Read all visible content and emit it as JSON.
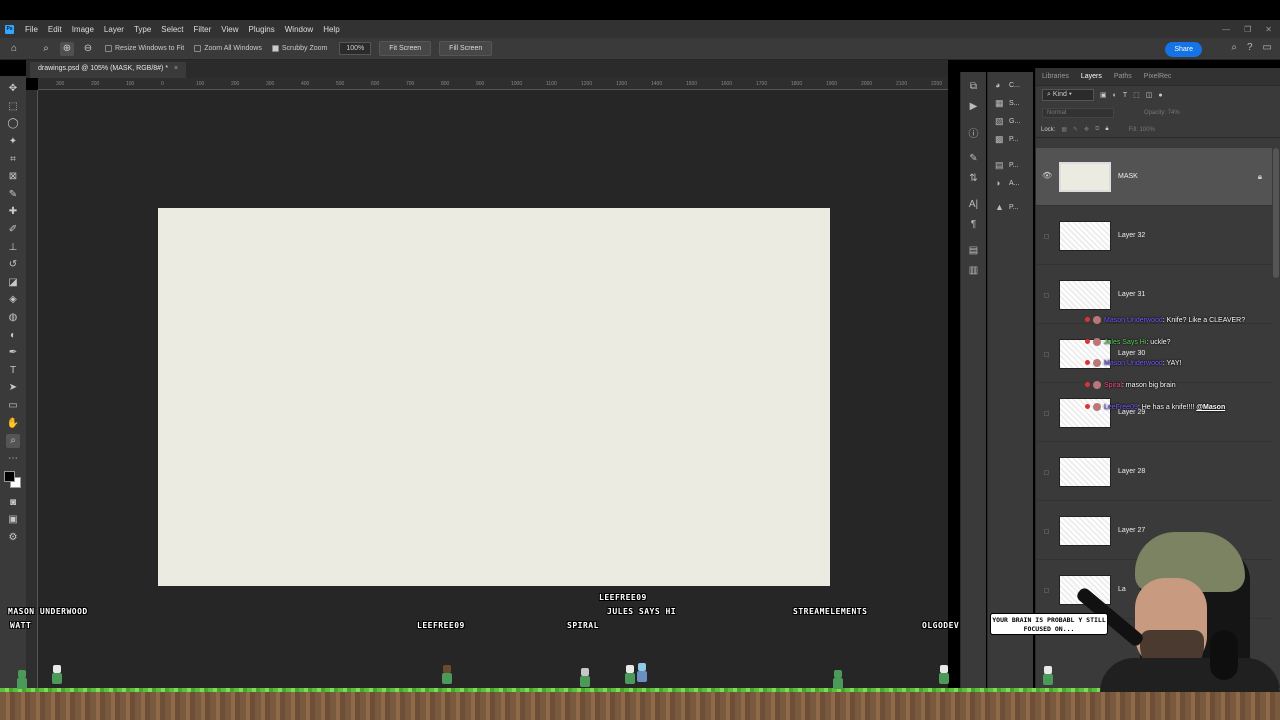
{
  "menu": {
    "items": [
      "File",
      "Edit",
      "Image",
      "Layer",
      "Type",
      "Select",
      "Filter",
      "View",
      "Plugins",
      "Window",
      "Help"
    ]
  },
  "options_bar": {
    "resize_windows": "Resize Windows to Fit",
    "zoom_all": "Zoom All Windows",
    "scrubby_zoom": "Scrubby Zoom",
    "zoom_value": "100%",
    "fit_screen": "Fit Screen",
    "fill_screen": "Fill Screen",
    "share": "Share"
  },
  "document": {
    "tab_title": "drawings.psd @ 105% (MASK, RGB/8#) *"
  },
  "ruler_labels": [
    "300",
    "200",
    "100",
    "0",
    "100",
    "200",
    "300",
    "400",
    "500",
    "600",
    "700",
    "800",
    "900",
    "1000",
    "1100",
    "1200",
    "1300",
    "1400",
    "1500",
    "1600",
    "1700",
    "1800",
    "1900",
    "2000",
    "2100",
    "2200"
  ],
  "mid_dock": [
    "C...",
    "S...",
    "G...",
    "P...",
    "P...",
    "A...",
    "P..."
  ],
  "layers_panel": {
    "tabs": [
      "Libraries",
      "Layers",
      "Paths",
      "PixelRec"
    ],
    "active_tab": "Layers",
    "kind": "Kind",
    "blend_mode": "Normal",
    "opacity_label": "Opacity:",
    "opacity_value": "74%",
    "lock_label": "Lock:",
    "fill_label": "Fill:",
    "fill_value": "100%",
    "layers": [
      {
        "name": "MASK",
        "selected": true,
        "visible": true,
        "locked": true
      },
      {
        "name": "Layer 32"
      },
      {
        "name": "Layer 31"
      },
      {
        "name": "Layer 30"
      },
      {
        "name": "Layer 29"
      },
      {
        "name": "Layer 28"
      },
      {
        "name": "Layer 27"
      },
      {
        "name": "La"
      }
    ]
  },
  "chat": [
    {
      "user": "Mason Underwood",
      "msg": "Knife? Like a CLEAVER?",
      "user_color": "#7b5cff"
    },
    {
      "user": "Jules Says Hi",
      "msg": "uckle?",
      "user_color": "#5bd35b"
    },
    {
      "user": "Mason Underwood",
      "msg": "YAY!",
      "user_color": "#7b5cff"
    },
    {
      "user": "Spiral",
      "msg": "mason big brain",
      "user_color": "#ff4e8a"
    },
    {
      "user": "LeeFree09",
      "msg": "He has a knife!!!!",
      "mention": "@Mason",
      "user_color": "#7b5cff"
    }
  ],
  "stream_names": {
    "mason": "MASON UNDERWOOD",
    "watt": "WATT",
    "leefree_a": "LEEFREE09",
    "leefree_b": "LEEFREE09",
    "jules": "JULES SAYS HI",
    "spiral": "SPIRAL",
    "streamelements": "STREAMELEMENTS",
    "olgodev": "OLGODEV"
  },
  "bubble_text": "YOUR BRAIN IS PROBABL Y STILL FOCUSED ON..."
}
